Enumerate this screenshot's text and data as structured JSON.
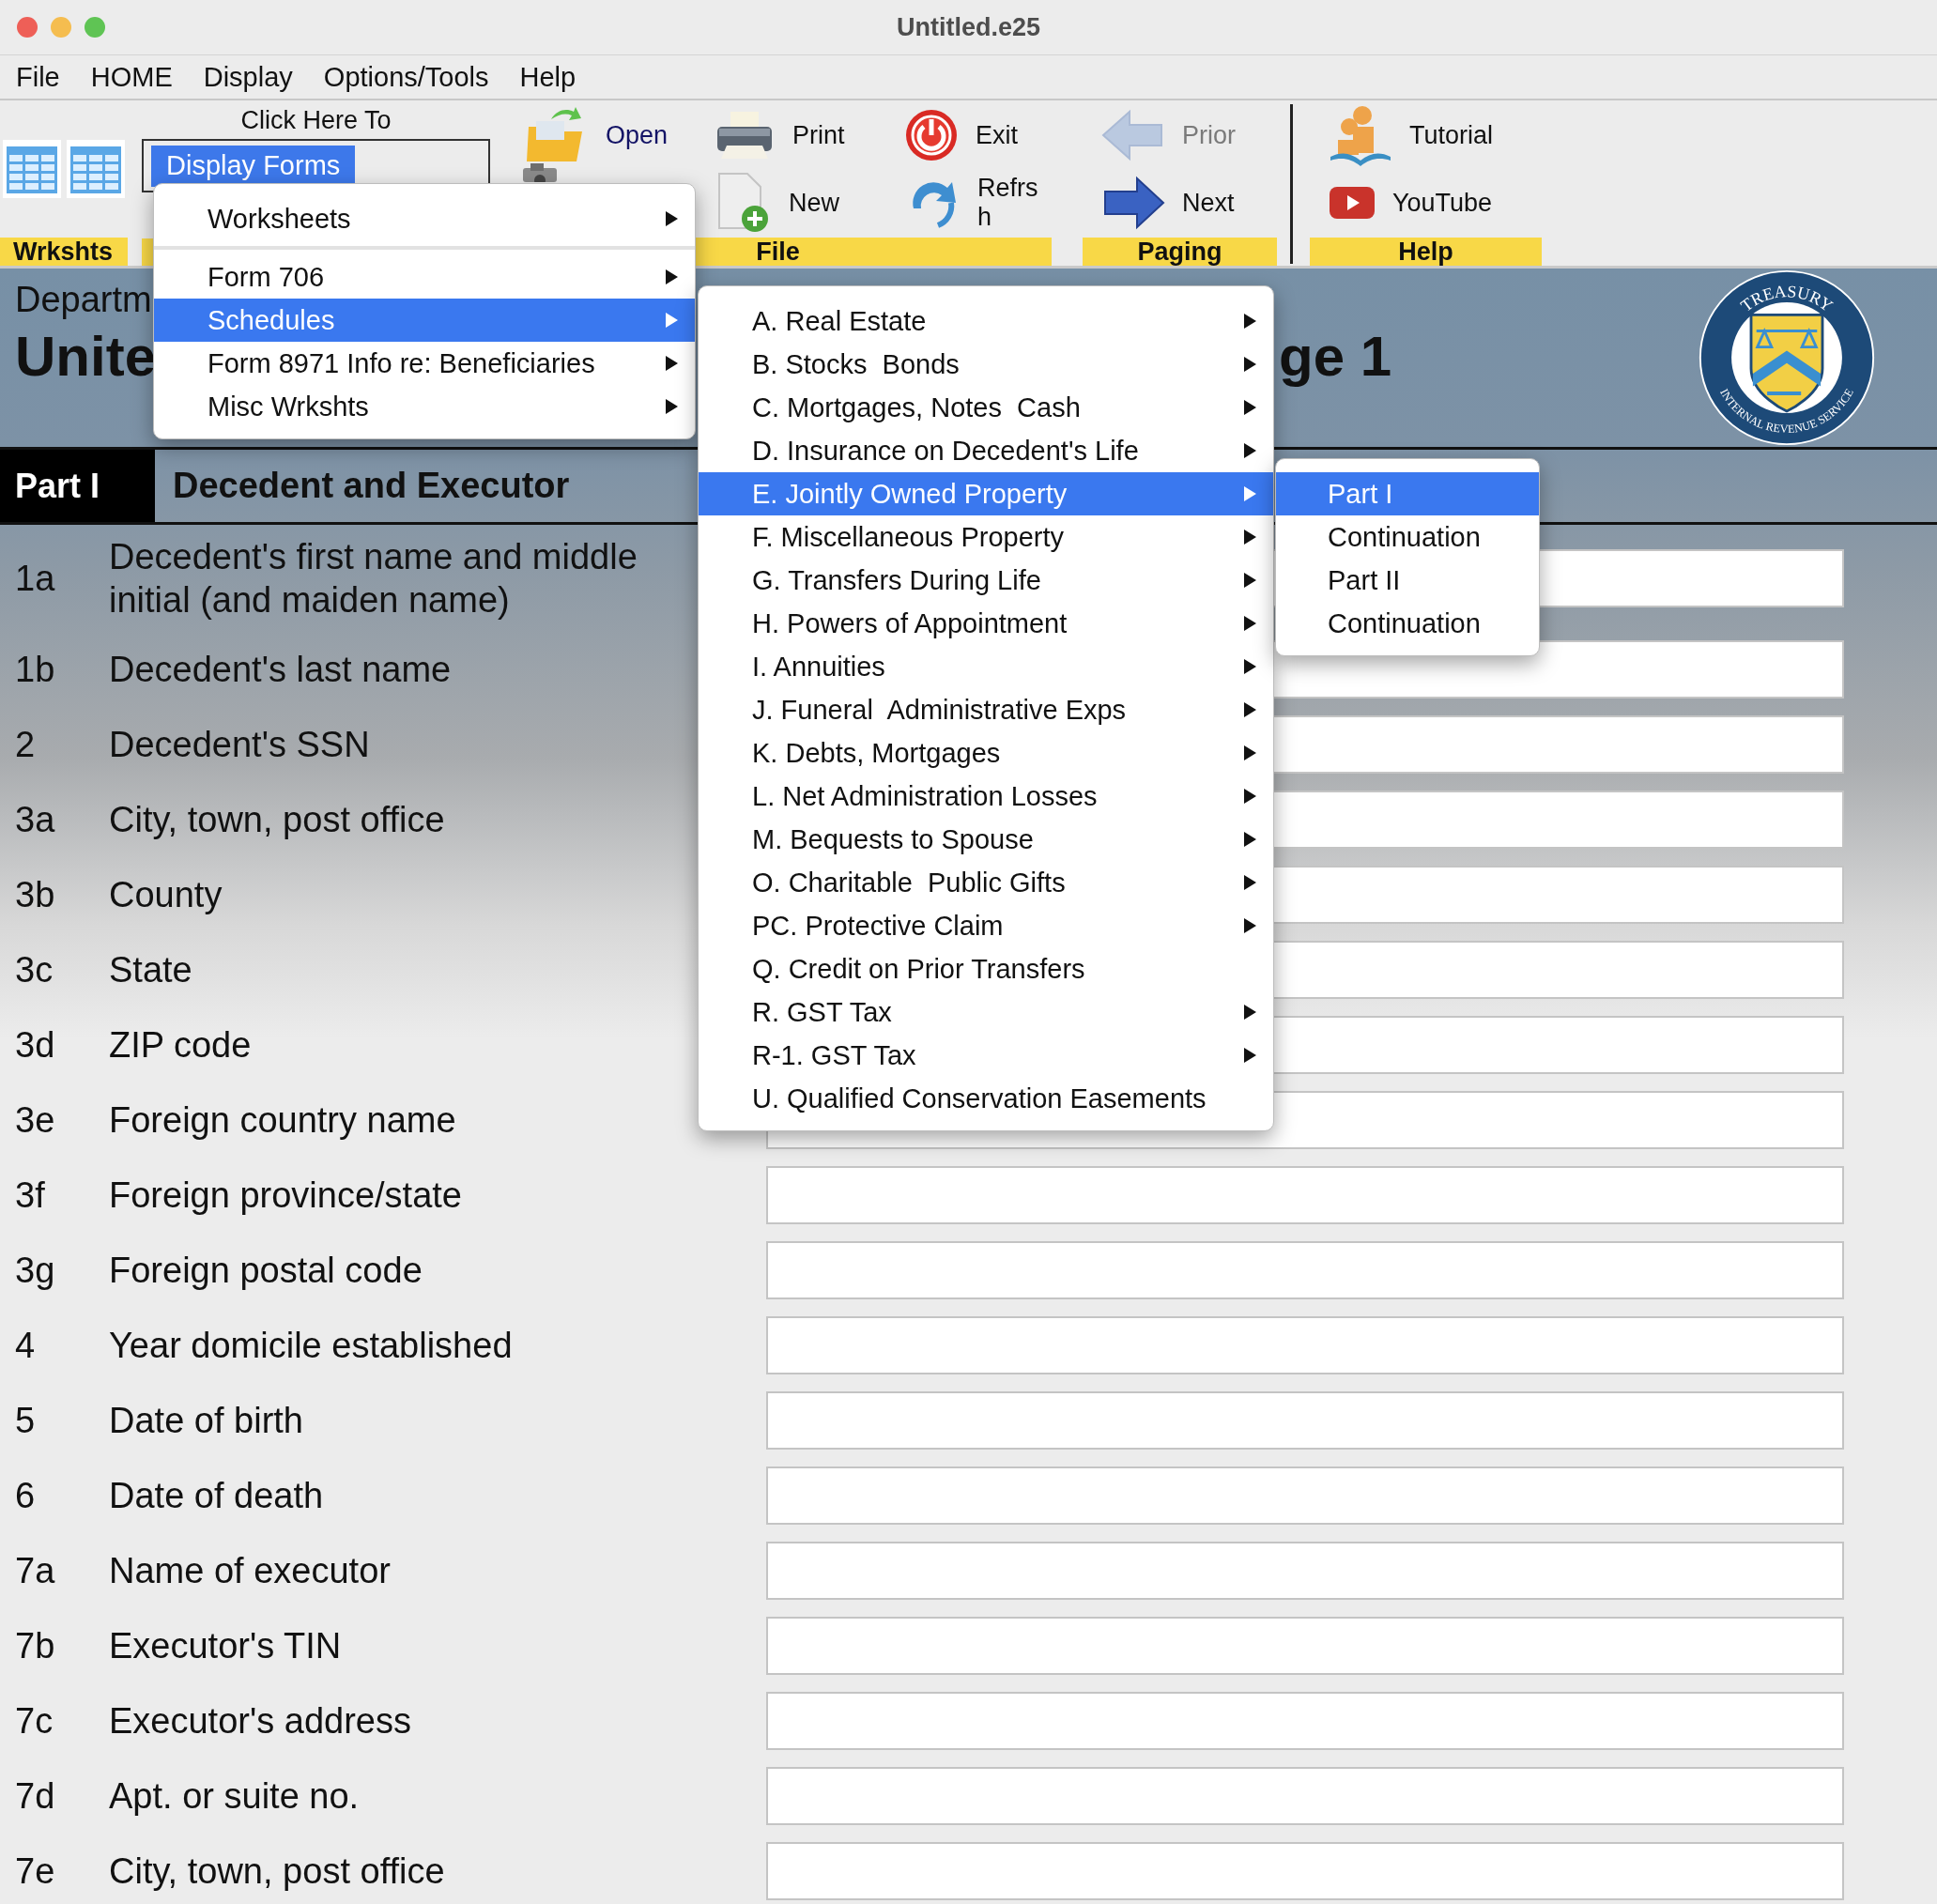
{
  "window": {
    "title": "Untitled.e25"
  },
  "menu_bar": [
    "File",
    "HOME",
    "Display",
    "Options/Tools",
    "Help"
  ],
  "toolbar": {
    "worksheets": {
      "label": "Wrkshts"
    },
    "display_forms": {
      "caption": "Click Here To",
      "button": "Display Forms"
    },
    "groups": [
      {
        "label": "File",
        "buttons": [
          {
            "kind": "open",
            "label": "Open",
            "disabled": false
          },
          {
            "kind": "camera"
          },
          {
            "kind": "print",
            "label": "Print",
            "disabled": false
          },
          {
            "kind": "new",
            "label": "New",
            "disabled": false
          },
          {
            "kind": "exit",
            "label": "Exit",
            "disabled": false
          },
          {
            "kind": "refresh",
            "label": "Refrs\nh",
            "disabled": false
          }
        ]
      },
      {
        "label": "Paging",
        "buttons": [
          {
            "kind": "prior",
            "label": "Prior",
            "disabled": true
          },
          {
            "kind": "next",
            "label": "Next",
            "disabled": false
          }
        ]
      },
      {
        "label": "Help",
        "buttons": [
          {
            "kind": "tutorial",
            "label": "Tutorial",
            "disabled": false
          },
          {
            "kind": "youtube",
            "label": "YouTube",
            "disabled": false
          }
        ]
      }
    ]
  },
  "form": {
    "header": {
      "department": "Departm",
      "title_left": "Unite",
      "title_right": "ge 1",
      "seal": {
        "top": "TREASURY",
        "bottom": "INTERNAL REVENUE SERVICE"
      }
    },
    "part": {
      "number": "Part I",
      "title": "Decedent and Executor"
    },
    "rows": [
      {
        "num": "1a",
        "label": "Decedent's first name and middle initial (and maiden name)"
      },
      {
        "num": "1b",
        "label": "Decedent's last name"
      },
      {
        "num": "2",
        "label": "Decedent's SSN"
      },
      {
        "num": "3a",
        "label": "City, town, post office"
      },
      {
        "num": "3b",
        "label": "County"
      },
      {
        "num": "3c",
        "label": "State"
      },
      {
        "num": "3d",
        "label": "ZIP code"
      },
      {
        "num": "3e",
        "label": "Foreign country name"
      },
      {
        "num": "3f",
        "label": "Foreign province/state"
      },
      {
        "num": "3g",
        "label": "Foreign postal code"
      },
      {
        "num": "4",
        "label": "Year domicile established"
      },
      {
        "num": "5",
        "label": "Date of birth"
      },
      {
        "num": "6",
        "label": "Date of death"
      },
      {
        "num": "7a",
        "label": "Name of executor"
      },
      {
        "num": "7b",
        "label": "Executor's TIN"
      },
      {
        "num": "7c",
        "label": "Executor's address"
      },
      {
        "num": "7d",
        "label": "Apt. or suite no."
      },
      {
        "num": "7e",
        "label": "City, town, post office"
      }
    ]
  },
  "menus": [
    [
      {
        "kind": "item",
        "label": "Worksheets",
        "selected": false,
        "has_submenu": true
      },
      {
        "kind": "separator"
      },
      {
        "kind": "item",
        "label": "Form 706",
        "selected": false,
        "has_submenu": true
      },
      {
        "kind": "item",
        "label": "Schedules",
        "selected": true,
        "has_submenu": true
      },
      {
        "kind": "item",
        "label": "Form 8971 Info re: Beneficiaries",
        "selected": false,
        "has_submenu": true
      },
      {
        "kind": "item",
        "label": "Misc Wrkshts",
        "selected": false,
        "has_submenu": true
      }
    ],
    [
      {
        "kind": "item",
        "label": "A. Real Estate",
        "selected": false,
        "has_submenu": true
      },
      {
        "kind": "item",
        "label": "B. Stocks  Bonds",
        "selected": false,
        "has_submenu": true
      },
      {
        "kind": "item",
        "label": "C. Mortgages, Notes  Cash",
        "selected": false,
        "has_submenu": true
      },
      {
        "kind": "item",
        "label": "D. Insurance on Decedent's Life",
        "selected": false,
        "has_submenu": true
      },
      {
        "kind": "item",
        "label": "E. Jointly Owned Property",
        "selected": true,
        "has_submenu": true
      },
      {
        "kind": "item",
        "label": "F. Miscellaneous Property",
        "selected": false,
        "has_submenu": true
      },
      {
        "kind": "item",
        "label": "G. Transfers During Life",
        "selected": false,
        "has_submenu": true
      },
      {
        "kind": "item",
        "label": "H. Powers of Appointment",
        "selected": false,
        "has_submenu": true
      },
      {
        "kind": "item",
        "label": "I. Annuities",
        "selected": false,
        "has_submenu": true
      },
      {
        "kind": "item",
        "label": "J. Funeral  Administrative Exps",
        "selected": false,
        "has_submenu": true
      },
      {
        "kind": "item",
        "label": "K. Debts, Mortgages",
        "selected": false,
        "has_submenu": true
      },
      {
        "kind": "item",
        "label": "L. Net Administration Losses",
        "selected": false,
        "has_submenu": true
      },
      {
        "kind": "item",
        "label": "M. Bequests to Spouse",
        "selected": false,
        "has_submenu": true
      },
      {
        "kind": "item",
        "label": "O. Charitable  Public Gifts",
        "selected": false,
        "has_submenu": true
      },
      {
        "kind": "item",
        "label": "PC. Protective Claim",
        "selected": false,
        "has_submenu": true
      },
      {
        "kind": "item",
        "label": "Q. Credit on Prior Transfers",
        "selected": false,
        "has_submenu": false
      },
      {
        "kind": "item",
        "label": "R. GST Tax",
        "selected": false,
        "has_submenu": true
      },
      {
        "kind": "item",
        "label": "R-1. GST Tax",
        "selected": false,
        "has_submenu": true
      },
      {
        "kind": "item",
        "label": "U. Qualified Conservation Easements",
        "selected": false,
        "has_submenu": false
      }
    ],
    [
      {
        "kind": "item",
        "label": "Part I",
        "selected": true,
        "has_submenu": false
      },
      {
        "kind": "item",
        "label": "Continuation",
        "selected": false,
        "has_submenu": false
      },
      {
        "kind": "item",
        "label": "Part II",
        "selected": false,
        "has_submenu": false
      },
      {
        "kind": "item",
        "label": "Continuation",
        "selected": false,
        "has_submenu": false
      }
    ]
  ]
}
